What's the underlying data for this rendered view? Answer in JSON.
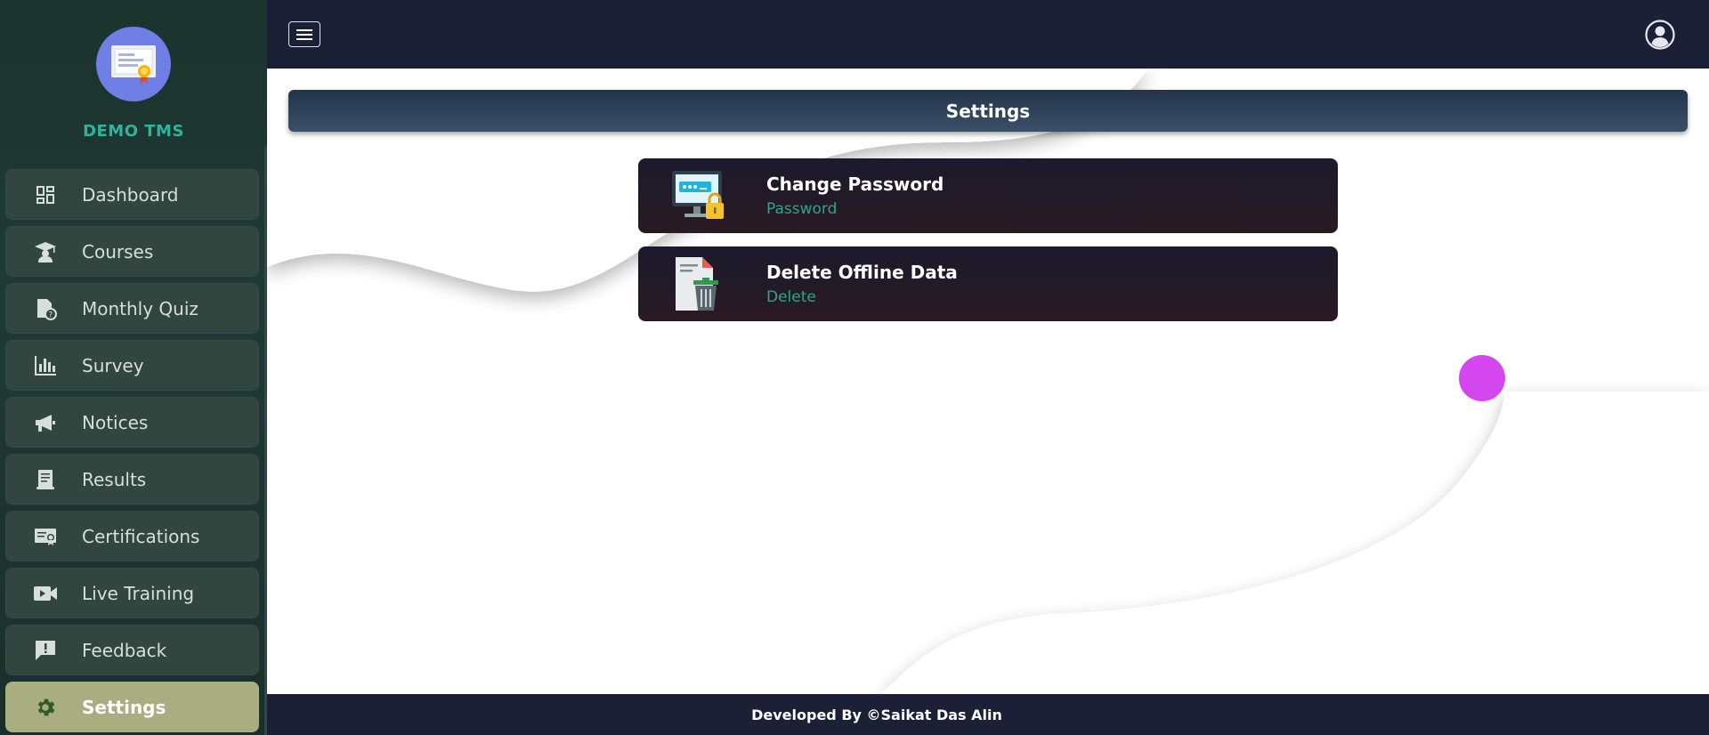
{
  "brand": {
    "name": "DEMO TMS",
    "logo_icon": "certificate-icon"
  },
  "sidebar": {
    "items": [
      {
        "label": "Dashboard",
        "icon": "dashboard-icon"
      },
      {
        "label": "Courses",
        "icon": "graduation-icon"
      },
      {
        "label": "Monthly Quiz",
        "icon": "quiz-file-icon"
      },
      {
        "label": "Survey",
        "icon": "bar-chart-icon"
      },
      {
        "label": "Notices",
        "icon": "megaphone-icon"
      },
      {
        "label": "Results",
        "icon": "scroll-icon"
      },
      {
        "label": "Certifications",
        "icon": "certificate-card-icon"
      },
      {
        "label": "Live Training",
        "icon": "video-camera-icon"
      },
      {
        "label": "Feedback",
        "icon": "feedback-icon"
      },
      {
        "label": "Settings",
        "icon": "gear-icon",
        "active": true
      }
    ]
  },
  "header": {
    "menu_icon": "hamburger-icon",
    "user_icon": "user-circle-icon"
  },
  "page": {
    "title": "Settings"
  },
  "cards": [
    {
      "title": "Change Password",
      "subtitle": "Password",
      "icon": "monitor-lock-icon"
    },
    {
      "title": "Delete Offline Data",
      "subtitle": "Delete",
      "icon": "trash-document-icon"
    }
  ],
  "footer": {
    "text": "Developed By ©Saikat Das Alin"
  },
  "colors": {
    "sidebar_bg": "#1f3a34",
    "brand_text": "#2fb39c",
    "active_item": "#a9ad80",
    "topbar_bg": "#1b2036",
    "accent_dot": "#d547ee",
    "card_subtitle": "#2aa58e"
  }
}
